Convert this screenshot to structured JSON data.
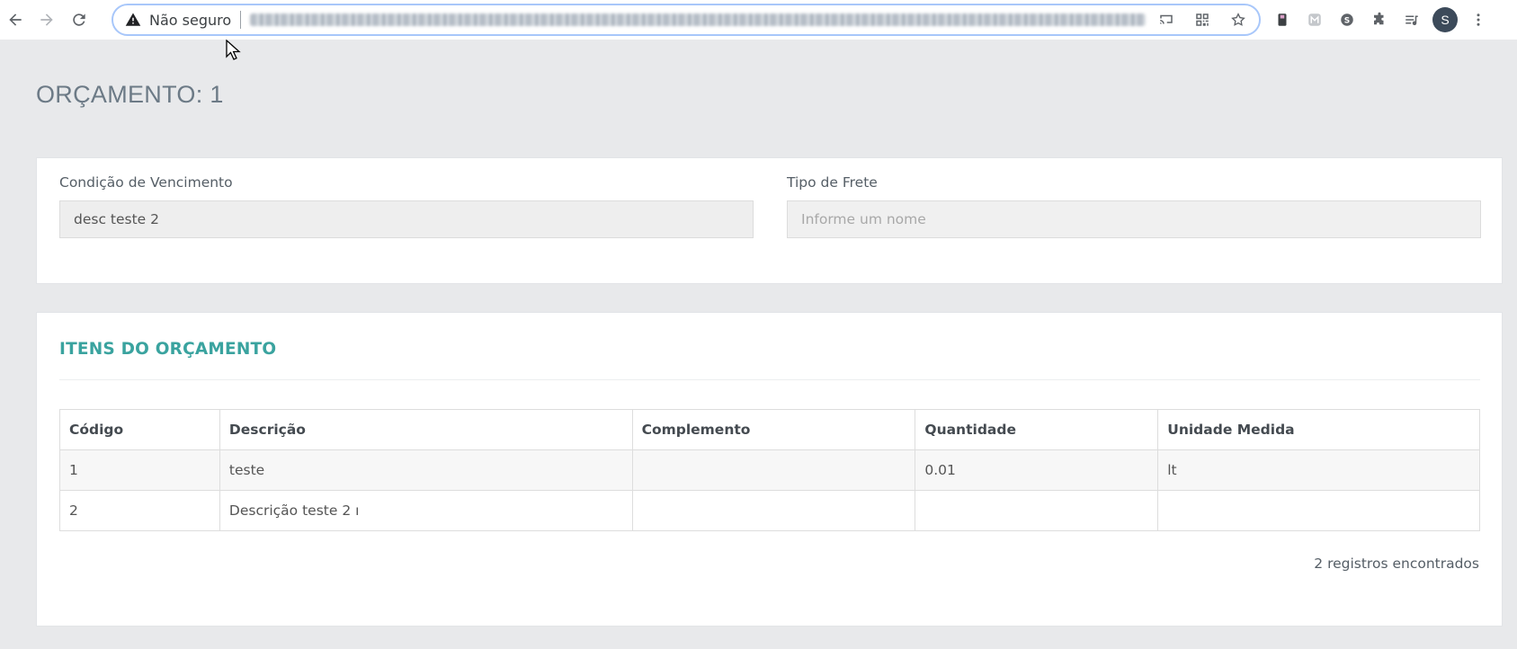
{
  "browser": {
    "security_label": "Não seguro",
    "avatar_initial": "S"
  },
  "page": {
    "title": "ORÇAMENTO: 1"
  },
  "form": {
    "condicao": {
      "label": "Condição de Vencimento",
      "value": "desc teste 2"
    },
    "frete": {
      "label": "Tipo de Frete",
      "placeholder": "Informe um nome",
      "value": ""
    }
  },
  "items_section": {
    "title": "ITENS DO ORÇAMENTO",
    "columns": [
      "Código",
      "Descrição",
      "Complemento",
      "Quantidade",
      "Unidade Medida"
    ],
    "rows": [
      [
        "1",
        "teste",
        "",
        "0.01",
        "lt"
      ],
      [
        "2",
        "Descrição teste 2 ı",
        "",
        "",
        ""
      ]
    ],
    "footer": "2 registros encontrados"
  },
  "colors": {
    "accent": "#3aa39f",
    "background": "#e8e9eb",
    "title": "#6c7a86"
  }
}
